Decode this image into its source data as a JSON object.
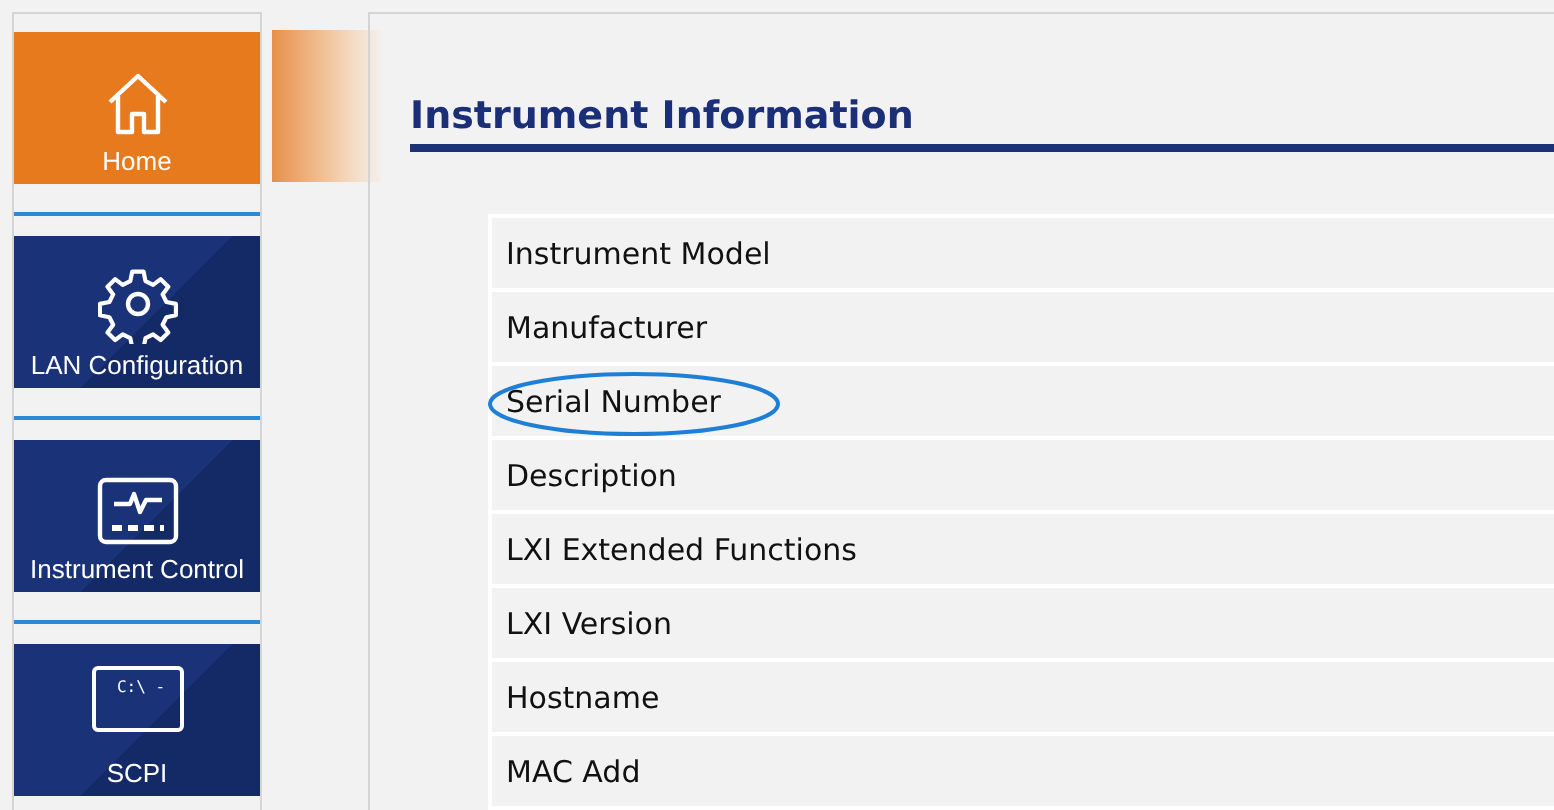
{
  "nav": [
    {
      "kind": "home",
      "label": "Home",
      "selected": true
    },
    {
      "kind": "gear",
      "label": "LAN Configuration",
      "selected": false
    },
    {
      "kind": "monitor",
      "label": "Instrument Control",
      "selected": false
    },
    {
      "kind": "terminal",
      "label": "SCPI",
      "selected": false,
      "prompt": "C:\\ -"
    }
  ],
  "section": {
    "title": "Instrument Information"
  },
  "rows": [
    {
      "label": "Instrument Model",
      "circled": false
    },
    {
      "label": "Manufacturer",
      "circled": false
    },
    {
      "label": "Serial Number",
      "circled": true
    },
    {
      "label": "Description",
      "circled": false
    },
    {
      "label": "LXI Extended Functions",
      "circled": false
    },
    {
      "label": "LXI Version",
      "circled": false
    },
    {
      "label": "Hostname",
      "circled": false
    },
    {
      "label": "MAC Add",
      "circled": false
    }
  ]
}
